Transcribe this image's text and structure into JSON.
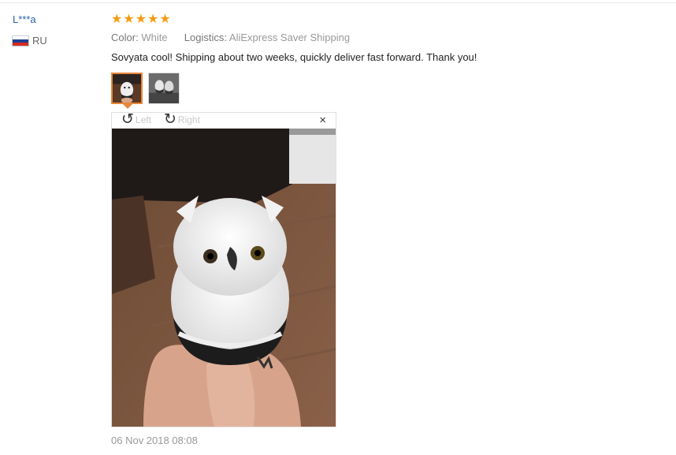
{
  "review": {
    "user_name": "L***a",
    "country": "RU",
    "rating": 5,
    "rating_stars": [
      "★",
      "★",
      "★",
      "★",
      "★"
    ],
    "color_label": "Color:",
    "color_value": "White",
    "logistics_label": "Logistics:",
    "logistics_value": "AliExpress Saver Shipping",
    "text": "Sovyata cool! Shipping about two weeks, quickly deliver fast forward. Thank you!",
    "timestamp": "06 Nov 2018 08:08"
  },
  "viewer": {
    "rotate_left_label": "Left",
    "rotate_right_label": "Right",
    "close_glyph": "×",
    "rotate_left_icon": "rotate-left-icon",
    "rotate_right_icon": "rotate-right-icon"
  },
  "photos": [
    {
      "name": "owl-photo-1",
      "selected": true
    },
    {
      "name": "owl-photo-2",
      "selected": false
    }
  ],
  "colors": {
    "star": "#f39c12",
    "user_link": "#2a5fa8",
    "thumb_selected_border": "#e8863a",
    "flag": [
      "#ffffff",
      "#1c3f94",
      "#d52b1e"
    ]
  }
}
